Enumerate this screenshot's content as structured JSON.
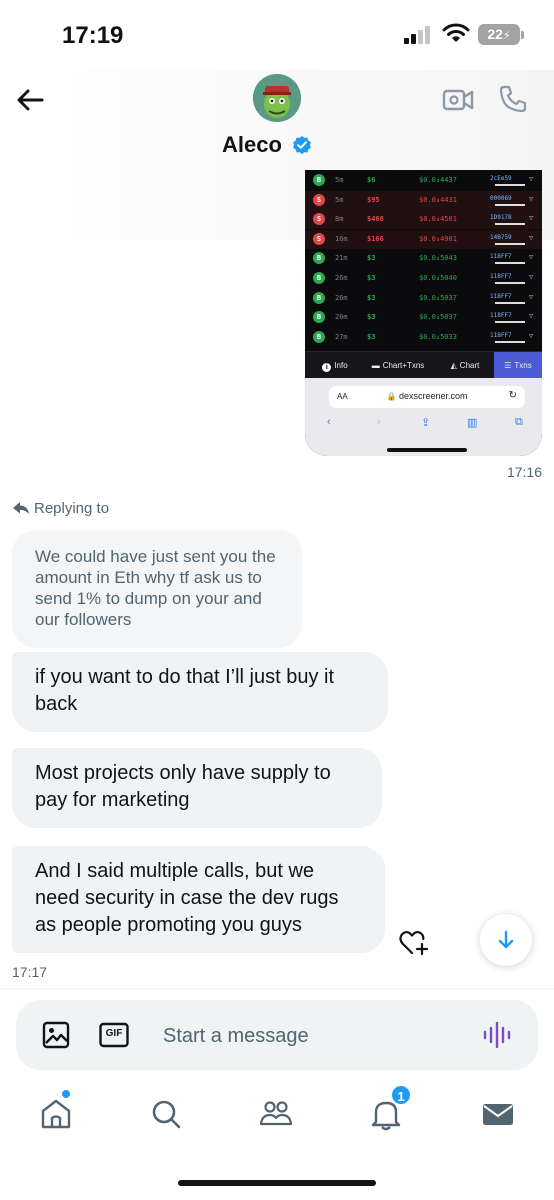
{
  "status_bar": {
    "time": "17:19",
    "battery": "22"
  },
  "header": {
    "contact_name": "Aleco"
  },
  "shared_screenshot": {
    "transactions": [
      {
        "type": "B",
        "age": "5m",
        "usd": "$6",
        "price": "$0.0₄4437",
        "maker": "2cEe59",
        "side": "buy"
      },
      {
        "type": "S",
        "age": "5m",
        "usd": "$95",
        "price": "$0.0₄4431",
        "maker": "000069",
        "side": "sell"
      },
      {
        "type": "S",
        "age": "8m",
        "usd": "$468",
        "price": "$0.0₄4501",
        "maker": "1D9178",
        "side": "sell"
      },
      {
        "type": "S",
        "age": "16m",
        "usd": "$166",
        "price": "$0.0₄4901",
        "maker": "14B759",
        "side": "sell"
      },
      {
        "type": "B",
        "age": "21m",
        "usd": "$3",
        "price": "$0.0₄5043",
        "maker": "118FF7",
        "side": "buy"
      },
      {
        "type": "B",
        "age": "26m",
        "usd": "$3",
        "price": "$0.0₄5040",
        "maker": "118FF7",
        "side": "buy"
      },
      {
        "type": "B",
        "age": "26m",
        "usd": "$3",
        "price": "$0.0₄5037",
        "maker": "118FF7",
        "side": "buy"
      },
      {
        "type": "B",
        "age": "26m",
        "usd": "$3",
        "price": "$0.0₄5037",
        "maker": "118FF7",
        "side": "buy"
      },
      {
        "type": "B",
        "age": "27m",
        "usd": "$3",
        "price": "$0.0₄5033",
        "maker": "118FF7",
        "side": "buy"
      }
    ],
    "tabs": [
      "Info",
      "Chart+Txns",
      "Chart",
      "Txns"
    ],
    "active_tab": "Txns",
    "browser": {
      "aa_label": "AA",
      "url": "dexscreener.com"
    },
    "time": "17:16"
  },
  "replying_label": "Replying to",
  "messages": [
    {
      "text": "We could have just sent you the amount in Eth why tf ask us to send 1% to dump on your and our followers",
      "quoted": true
    },
    {
      "text": "if you want to do that I’ll just buy it back",
      "quoted": false
    },
    {
      "text": "Most projects only have supply to pay for marketing",
      "quoted": false
    },
    {
      "text": "And I said multiple calls, but we need security in case the dev rugs as people promoting you guys",
      "quoted": false
    }
  ],
  "last_message_time": "17:17",
  "composer": {
    "placeholder": "Start a message",
    "gif_label": "GIF"
  },
  "bottom_nav": {
    "notifications_count": "1"
  },
  "colors": {
    "accent": "#1d9bf0",
    "bubble": "#eff3f4",
    "buy": "#2ea84f",
    "sell": "#e04848",
    "voice": "#794bc4"
  },
  "icons": [
    "back-arrow-icon",
    "video-call-icon",
    "phone-icon",
    "verified-badge-icon",
    "reply-arrow-icon",
    "heart-plus-icon",
    "arrow-down-icon",
    "image-icon",
    "gif-icon",
    "voice-icon",
    "home-icon",
    "search-icon",
    "communities-icon",
    "bell-icon",
    "mail-icon"
  ]
}
